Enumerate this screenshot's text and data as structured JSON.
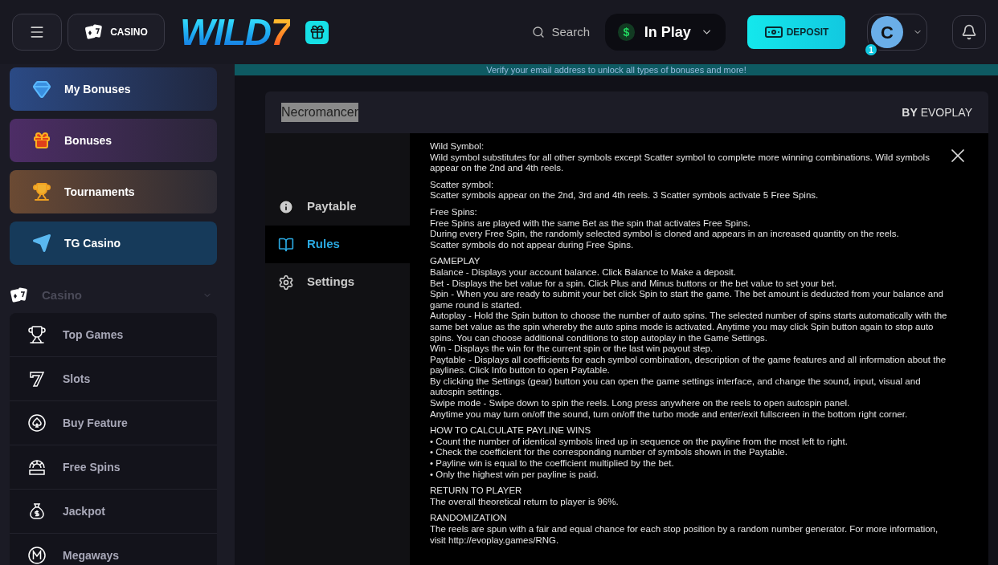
{
  "header": {
    "casino_button": "CASINO",
    "logo": {
      "main": "WILD",
      "accent": "7"
    },
    "search": "Search",
    "balance": {
      "label": "In Play",
      "currency": "$"
    },
    "deposit": "DEPOSIT",
    "avatar": {
      "initial": "C",
      "badge": "1"
    }
  },
  "sidebar": {
    "promos": [
      {
        "label": "My Bonuses",
        "kind": "diamond"
      },
      {
        "label": "Bonuses",
        "kind": "gift"
      },
      {
        "label": "Tournaments",
        "kind": "trophy"
      },
      {
        "label": "TG Casino",
        "kind": "plane"
      }
    ],
    "section": {
      "label": "Casino",
      "expanded": true,
      "items": [
        {
          "label": "Top Games",
          "kind": "cup"
        },
        {
          "label": "Slots",
          "kind": "seven"
        },
        {
          "label": "Buy Feature",
          "kind": "spade"
        },
        {
          "label": "Free Spins",
          "kind": "free"
        },
        {
          "label": "Jackpot",
          "kind": "bag"
        },
        {
          "label": "Megaways",
          "kind": "m"
        }
      ]
    }
  },
  "banner": "Verify your email address to unlock all types of bonuses and more!",
  "game": {
    "title": "Necromancer",
    "by": "BY",
    "provider": "EVOPLAY",
    "menu": [
      {
        "label": "Paytable",
        "kind": "info",
        "selected": false
      },
      {
        "label": "Rules",
        "kind": "book",
        "selected": true
      },
      {
        "label": "Settings",
        "kind": "gear",
        "selected": false
      }
    ],
    "rules": [
      {
        "heading": "Wild Symbol:",
        "lines": [
          "Wild symbol substitutes for all other symbols except Scatter symbol to complete more winning combinations. Wild symbols appear on the 2nd and 4th reels."
        ]
      },
      {
        "heading": "Scatter symbol:",
        "lines": [
          "Scatter symbols appear on the 2nd, 3rd and 4th reels. 3 Scatter symbols activate 5 Free Spins."
        ]
      },
      {
        "heading": "Free Spins:",
        "lines": [
          "Free Spins are played with the same Bet as the spin that activates Free Spins.",
          "During every Free Spin, the randomly selected symbol is cloned and appears in an increased quantity on the reels.",
          "Scatter symbols do not appear during Free Spins."
        ]
      },
      {
        "heading": "GAMEPLAY",
        "lines": [
          "Balance - Displays your account balance. Click Balance to Make a deposit.",
          "Bet - Displays the bet value for a spin. Click Plus and Minus buttons or the bet value to set your bet.",
          "Spin - When you are ready to submit your bet click Spin to start the game. The bet amount is deducted from your balance and game round is started.",
          "Autoplay - Hold the Spin button to choose the number of auto spins. The selected number of spins starts automatically with the same bet value as the spin whereby the auto spins mode is activated. Anytime you may click Spin button again to stop auto spins. You can choose additional conditions to stop autoplay in the Game Settings.",
          "Win - Displays the win for the current spin or the last win payout step.",
          "Paytable - Displays all coefficients for each symbol combination, description of the game features and all information about the paylines. Click Info button to open Paytable.",
          "By clicking the Settings (gear) button you can open the game settings interface, and change the sound, input, visual and autospin settings.",
          "Swipe mode - Swipe down to spin the reels. Long press anywhere on the reels to open autospin panel.",
          "Anytime you may turn on/off the sound, turn on/off the turbo mode and enter/exit fullscreen in the bottom right corner."
        ]
      },
      {
        "heading": "HOW TO CALCULATE PAYLINE WINS",
        "lines": [
          "• Count the number of identical symbols lined up in sequence on the payline from the most left to right.",
          "• Check the coefficient for the corresponding number of symbols shown in the Paytable.",
          "• Payline win is equal to the coefficient multiplied by the bet.",
          "• Only the highest win per payline is paid."
        ]
      },
      {
        "heading": "RETURN TO PLAYER",
        "lines": [
          "The overall theoretical return to player is 96%."
        ]
      },
      {
        "heading": "RANDOMIZATION",
        "lines": [
          "The reels are spun with a fair and equal chance for each stop position by a random number generator. For more information, visit http://evoplay.games/RNG."
        ]
      }
    ]
  }
}
